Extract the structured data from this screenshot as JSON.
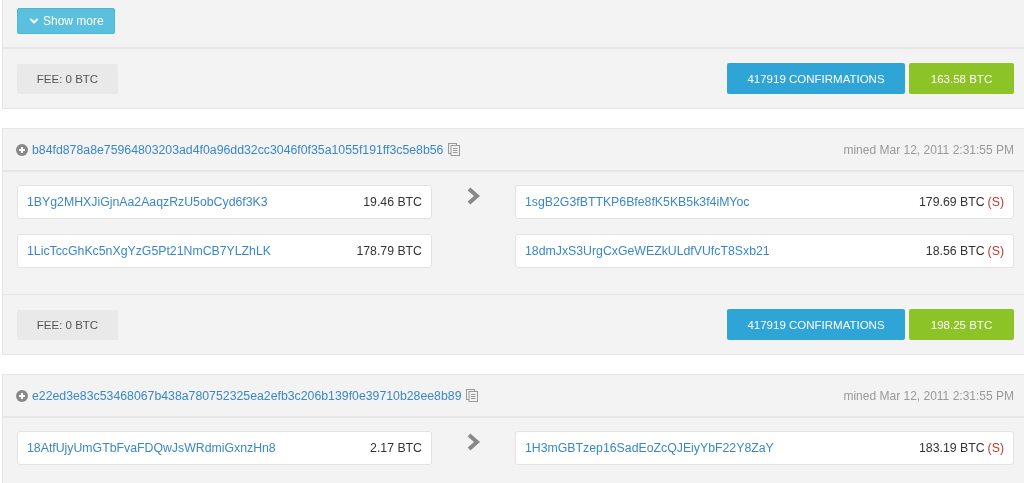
{
  "transactions": [
    {
      "show_more": "Show more",
      "fee": "FEE: 0 BTC",
      "confirmations": "417919 CONFIRMATIONS",
      "total": "163.58 BTC"
    },
    {
      "hash": "b84fd878a8e75964803203ad4f0a96dd32cc3046f0f35a1055f191ff3c5e8b56",
      "mined": "mined Mar 12, 2011 2:31:55 PM",
      "inputs": [
        {
          "address": "1BYg2MHXJiGjnAa2AaqzRzU5obCyd6f3K3",
          "amount": "19.46 BTC"
        },
        {
          "address": "1LicTccGhKc5nXgYzG5Pt21NmCB7YLZhLK",
          "amount": "178.79 BTC"
        }
      ],
      "outputs": [
        {
          "address": "1sgB2G3fBTTKP6Bfe8fK5KB5k3f4iMYoc",
          "amount": "179.69 BTC",
          "spent_mark": "(S)"
        },
        {
          "address": "18dmJxS3UrgCxGeWEZkULdfVUfcT8Sxb21",
          "amount": "18.56 BTC",
          "spent_mark": "(S)"
        }
      ],
      "fee": "FEE: 0 BTC",
      "confirmations": "417919 CONFIRMATIONS",
      "total": "198.25 BTC"
    },
    {
      "hash": "e22ed3e83c53468067b438a780752325ea2efb3c206b139f0e39710b28ee8b89",
      "mined": "mined Mar 12, 2011 2:31:55 PM",
      "inputs": [
        {
          "address": "18AtfUjyUmGTbFvaFDQwJsWRdmiGxnzHn8",
          "amount": "2.17 BTC"
        }
      ],
      "outputs": [
        {
          "address": "1H3mGBTzep16SadEoZcQJEiyYbF22Y8ZaY",
          "amount": "183.19 BTC",
          "spent_mark": "(S)"
        }
      ]
    }
  ]
}
